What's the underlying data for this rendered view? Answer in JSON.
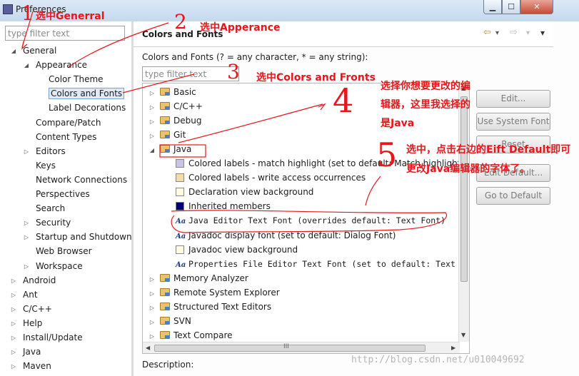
{
  "window": {
    "title": "Preferences",
    "buttons": {
      "minimize": "▁",
      "maximize": "☐",
      "close": "✕"
    },
    "accent": "#cfe1f3"
  },
  "left": {
    "filter_placeholder": "type filter text",
    "tree": [
      {
        "label": "General",
        "twisty": "◢"
      },
      {
        "label": "Appearance",
        "twisty": "◢"
      },
      {
        "label": "Color Theme",
        "twisty": ""
      },
      {
        "label": "Colors and Fonts",
        "twisty": ""
      },
      {
        "label": "Label Decorations",
        "twisty": ""
      },
      {
        "label": "Compare/Patch",
        "twisty": ""
      },
      {
        "label": "Content Types",
        "twisty": ""
      },
      {
        "label": "Editors",
        "twisty": "▷"
      },
      {
        "label": "Keys",
        "twisty": ""
      },
      {
        "label": "Network Connections",
        "twisty": ""
      },
      {
        "label": "Perspectives",
        "twisty": ""
      },
      {
        "label": "Search",
        "twisty": ""
      },
      {
        "label": "Security",
        "twisty": "▷"
      },
      {
        "label": "Startup and Shutdown",
        "twisty": "▷"
      },
      {
        "label": "Web Browser",
        "twisty": ""
      },
      {
        "label": "Workspace",
        "twisty": "▷"
      },
      {
        "label": "Android",
        "twisty": "▷"
      },
      {
        "label": "Ant",
        "twisty": "▷"
      },
      {
        "label": "C/C++",
        "twisty": "▷"
      },
      {
        "label": "Help",
        "twisty": "▷"
      },
      {
        "label": "Install/Update",
        "twisty": "▷"
      },
      {
        "label": "Java",
        "twisty": "▷"
      },
      {
        "label": "Maven",
        "twisty": "▷"
      }
    ]
  },
  "right": {
    "title": "Colors and Fonts",
    "nav": {
      "back": "⇦",
      "forward": "⇨",
      "menu": "▾"
    },
    "help_text": "Colors and Fonts (? = any character, * = any string):",
    "filter_placeholder": "type filter text",
    "tree": [
      {
        "label": "Basic",
        "twisty": "▷",
        "kind": "folder",
        "mono": false
      },
      {
        "label": "C/C++",
        "twisty": "▷",
        "kind": "folder",
        "mono": false
      },
      {
        "label": "Debug",
        "twisty": "▷",
        "kind": "folder",
        "mono": false
      },
      {
        "label": "Git",
        "twisty": "▷",
        "kind": "folder",
        "mono": false
      },
      {
        "label": "Java",
        "twisty": "◢",
        "kind": "folder",
        "mono": false
      },
      {
        "label": "Colored labels - match highlight (set to default: Match highlight)",
        "twisty": "",
        "kind": "swatch",
        "color": "#c9c3e6",
        "mono": false
      },
      {
        "label": "Colored labels - write access occurrences",
        "twisty": "",
        "kind": "swatch",
        "color": "#f2dcaa",
        "mono": false
      },
      {
        "label": "Declaration view background",
        "twisty": "",
        "kind": "swatch",
        "color": "#fffbe0",
        "mono": false
      },
      {
        "label": "Inherited members",
        "twisty": "",
        "kind": "swatch",
        "color": "#00007a",
        "mono": false
      },
      {
        "label": "Java Editor Text Font (overrides default: Text Font)",
        "twisty": "",
        "kind": "font",
        "mono": true
      },
      {
        "label": "Javadoc display font (set to default: Dialog Font)",
        "twisty": "",
        "kind": "font",
        "mono": false
      },
      {
        "label": "Javadoc view background",
        "twisty": "",
        "kind": "swatch",
        "color": "#fffbe0",
        "mono": false
      },
      {
        "label": "Properties File Editor Text Font (set to default: Text Font)",
        "twisty": "",
        "kind": "font",
        "mono": true
      },
      {
        "label": "Memory Analyzer",
        "twisty": "▷",
        "kind": "folder",
        "mono": false
      },
      {
        "label": "Remote System Explorer",
        "twisty": "▷",
        "kind": "folder",
        "mono": false
      },
      {
        "label": "Structured Text Editors",
        "twisty": "▷",
        "kind": "folder",
        "mono": false
      },
      {
        "label": "SVN",
        "twisty": "▷",
        "kind": "folder",
        "mono": false
      },
      {
        "label": "Text Compare",
        "twisty": "▷",
        "kind": "folder",
        "mono": false
      }
    ],
    "buttons": [
      "Edit...",
      "Use System Font",
      "Reset",
      "Edit Default...",
      "Go to Default"
    ],
    "description_label": "Description:",
    "scroll_thumb_marker": "III"
  },
  "annotations": {
    "step1_num": "1",
    "step1_text": "选中Generral",
    "step2_num": "2",
    "step2_text": "选中Apperance",
    "step3_num": "3",
    "step3_text": "选中Colors and Fronts",
    "step4_num": "4",
    "step4_text": [
      "选择你想要更改的编",
      "辑器，这里我选择的",
      "是Java"
    ],
    "step5_num": "5",
    "step5_text": [
      "选中，点击右边的Eift Default即可",
      "更改Java编辑器的字体了。"
    ],
    "color": "#e8161b"
  },
  "watermark": "http://blog.csdn.net/u010049692"
}
